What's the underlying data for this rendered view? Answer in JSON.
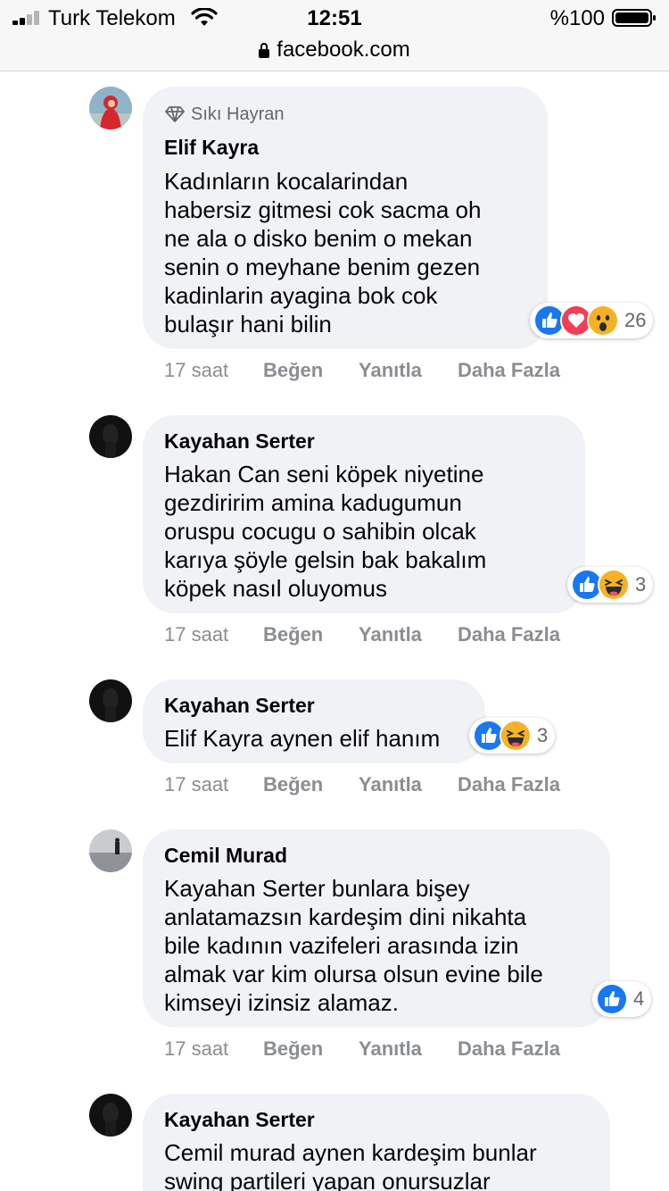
{
  "status_bar": {
    "carrier": "Turk Telekom",
    "time": "12:51",
    "battery": "%100"
  },
  "browser": {
    "url": "facebook.com"
  },
  "comments": [
    {
      "badge": "Sıkı Hayran",
      "author": "Elif Kayra",
      "text": "Kadınların kocalarindan\nhabersiz gitmesi cok sacma oh\nne ala o disko benim o mekan\nsenin o meyhane benim gezen\nkadinlarin ayagina bok cok\nbulaşır hani bilin",
      "reactions": [
        "like-icon",
        "love-icon",
        "wow-icon"
      ],
      "reaction_count": "26",
      "time": "17 saat",
      "like": "Beğen",
      "reply": "Yanıtla",
      "more": "Daha Fazla"
    },
    {
      "author": "Kayahan Serter",
      "text": "Hakan Can seni köpek niyetine\ngezdiririm amina kadugumun\noruspu cocugu o sahibin olcak\nkarıya şöyle gelsin bak bakalım\nköpek nasıl oluyomus",
      "reactions": [
        "like-icon",
        "haha-icon"
      ],
      "reaction_count": "3",
      "time": "17 saat",
      "like": "Beğen",
      "reply": "Yanıtla",
      "more": "Daha Fazla"
    },
    {
      "author": "Kayahan Serter",
      "text": "Elif Kayra aynen elif hanım",
      "reactions": [
        "like-icon",
        "haha-icon"
      ],
      "reaction_count": "3",
      "time": "17 saat",
      "like": "Beğen",
      "reply": "Yanıtla",
      "more": "Daha Fazla"
    },
    {
      "author": "Cemil Murad",
      "text": "Kayahan Serter bunlara bişey\nanlatamazsın kardeşim dini nikahta\nbile kadının vazifeleri arasında izin\nalmak var kim olursa olsun evine bile\nkimseyi izinsiz alamaz.",
      "reactions": [
        "like-icon"
      ],
      "reaction_count": "4",
      "time": "17 saat",
      "like": "Beğen",
      "reply": "Yanıtla",
      "more": "Daha Fazla"
    },
    {
      "author": "Kayahan Serter",
      "text": "Cemil murad aynen kardeşim bunlar\nswing partileri yapan onursuzlar"
    }
  ],
  "colors": {
    "like": "#1877f2",
    "love": "#f33e58",
    "reaction_yellow": "#f7b125",
    "bubble": "#f0f2f5",
    "meta_text": "#8a8d91"
  }
}
